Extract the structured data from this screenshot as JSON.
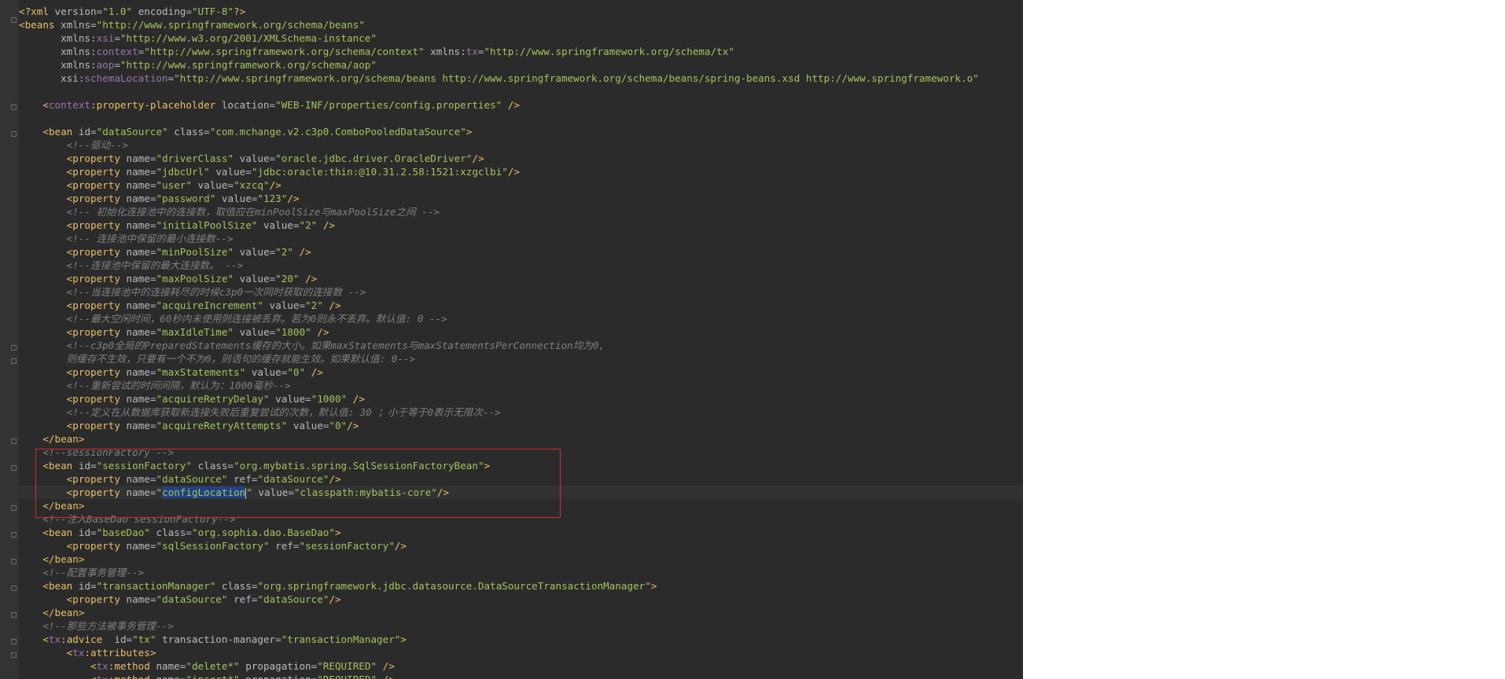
{
  "editor": {
    "lines": [
      "<?xml version=\"1.0\" encoding=\"UTF-8\"?>",
      "<beans xmlns=\"http://www.springframework.org/schema/beans\"",
      "       xmlns:xsi=\"http://www.w3.org/2001/XMLSchema-instance\"",
      "       xmlns:context=\"http://www.springframework.org/schema/context\" xmlns:tx=\"http://www.springframework.org/schema/tx\"",
      "       xmlns:aop=\"http://www.springframework.org/schema/aop\"",
      "       xsi:schemaLocation=\"http://www.springframework.org/schema/beans http://www.springframework.org/schema/beans/spring-beans.xsd http://www.springframework.or",
      "",
      "    <context:property-placeholder location=\"WEB-INF/properties/config.properties\" />",
      "",
      "    <bean id=\"dataSource\" class=\"com.mchange.v2.c3p0.ComboPooledDataSource\">",
      "        <!--驱动-->",
      "        <property name=\"driverClass\" value=\"oracle.jdbc.driver.OracleDriver\"/>",
      "        <property name=\"jdbcUrl\" value=\"jdbc:oracle:thin:@10.31.2.58:1521:xzgclbi\"/>",
      "        <property name=\"user\" value=\"xzcq\"/>",
      "        <property name=\"password\" value=\"123\"/>",
      "        <!-- 初始化连接池中的连接数，取值应在minPoolSize与maxPoolSize之间 -->",
      "        <property name=\"initialPoolSize\" value=\"2\" />",
      "        <!-- 连接池中保留的最小连接数-->",
      "        <property name=\"minPoolSize\" value=\"2\" />",
      "        <!--连接池中保留的最大连接数。 -->",
      "        <property name=\"maxPoolSize\" value=\"20\" />",
      "        <!--当连接池中的连接耗尽的时候c3p0一次同时获取的连接数 -->",
      "        <property name=\"acquireIncrement\" value=\"2\" />",
      "        <!--最大空闲时间，60秒内未使用则连接被丢弃。若为0则永不丢弃。默认值: 0 -->",
      "        <property name=\"maxIdleTime\" value=\"1800\" />",
      "        <!--c3p0全局的PreparedStatements缓存的大小。如果maxStatements与maxStatementsPerConnection均为0,",
      "        则缓存不生效，只要有一个不为0，则语句的缓存就能生效。如果默认值: 0-->",
      "        <property name=\"maxStatements\" value=\"0\" />",
      "        <!--重新尝试的时间间隔，默认为：1000毫秒-->",
      "        <property name=\"acquireRetryDelay\" value=\"1000\" />",
      "        <!--定义在从数据库获取新连接失败后重复尝试的次数，默认值: 30 ；小于等于0表示无限次-->",
      "        <property name=\"acquireRetryAttempts\" value=\"0\"/>",
      "    </bean>",
      "    <!--sessionFactory -->",
      "    <bean id=\"sessionFactory\" class=\"org.mybatis.spring.SqlSessionFactoryBean\">",
      "        <property name=\"dataSource\" ref=\"dataSource\"/>",
      "        <property name=\"configLocation\" value=\"classpath:mybatis-core\"/>",
      "    </bean>",
      "    <!--注入BaseDao sessionFactory-->",
      "    <bean id=\"baseDao\" class=\"org.sophia.dao.BaseDao\">",
      "        <property name=\"sqlSessionFactory\" ref=\"sessionFactory\"/>",
      "    </bean>",
      "    <!--配置事务管理-->",
      "    <bean id=\"transactionManager\" class=\"org.springframework.jdbc.datasource.DataSourceTransactionManager\">",
      "        <property name=\"dataSource\" ref=\"dataSource\"/>",
      "    </bean>",
      "    <!--那些方法被事务管理-->",
      "    <tx:advice  id=\"tx\" transaction-manager=\"transactionManager\">",
      "        <tx:attributes>",
      "            <tx:method name=\"delete*\" propagation=\"REQUIRED\" />",
      "            <tx:method name=\"insert*\" propagation=\"REQUIRED\" />"
    ],
    "selected_word": "configLocation",
    "colors": {
      "background": "#2b2b2b",
      "gutter": "#313335",
      "tag": "#e8bf6a",
      "attribute": "#bababa",
      "namespace": "#9876aa",
      "value": "#a5c25c",
      "comment": "#808080",
      "selection": "#214283",
      "annotation_box": "#d03030"
    }
  }
}
